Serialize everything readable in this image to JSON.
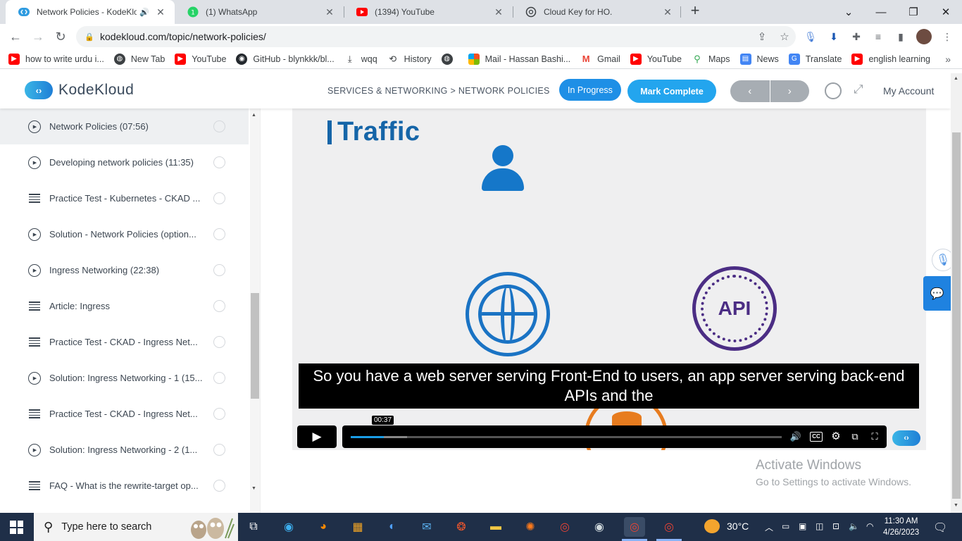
{
  "browser": {
    "tabs": [
      {
        "title": "Network Policies - KodeKlou",
        "favicon": "kodekloud-icon",
        "audio": true,
        "active": true
      },
      {
        "title": "(1) WhatsApp",
        "favicon": "whatsapp-icon",
        "active": false
      },
      {
        "title": "(1394) YouTube",
        "favicon": "youtube-icon",
        "active": false
      },
      {
        "title": "Cloud Key for HO.",
        "favicon": "chatgpt-icon",
        "active": false
      }
    ],
    "url": "kodekloud.com/topic/network-policies/",
    "bookmarks": [
      {
        "label": "how to write urdu i...",
        "icon": "youtube-icon"
      },
      {
        "label": "New Tab",
        "icon": "globe-icon"
      },
      {
        "label": "YouTube",
        "icon": "youtube-icon"
      },
      {
        "label": "GitHub - blynkkk/bl...",
        "icon": "github-icon"
      },
      {
        "label": "wqq",
        "icon": "download-icon"
      },
      {
        "label": "History",
        "icon": "history-icon"
      },
      {
        "label": "",
        "icon": "globe-icon"
      },
      {
        "label": "Mail - Hassan Bashi...",
        "icon": "microsoft-icon"
      },
      {
        "label": "Gmail",
        "icon": "gmail-icon"
      },
      {
        "label": "YouTube",
        "icon": "youtube-icon"
      },
      {
        "label": "Maps",
        "icon": "maps-icon"
      },
      {
        "label": "News",
        "icon": "news-icon"
      },
      {
        "label": "Translate",
        "icon": "translate-icon"
      },
      {
        "label": "english learning",
        "icon": "youtube-icon"
      }
    ]
  },
  "header": {
    "logo_text": "KodeKloud",
    "breadcrumb": "SERVICES & NETWORKING > NETWORK POLICIES",
    "status_label": "In Progress",
    "complete_label": "Mark Complete",
    "prev_label": "‹",
    "next_label": "›",
    "account_label": "My Account"
  },
  "sidebar": {
    "items": [
      {
        "title": "Network Policies (07:56)",
        "type": "video",
        "active": true
      },
      {
        "title": "Developing network policies (11:35)",
        "type": "video"
      },
      {
        "title": "Practice Test - Kubernetes - CKAD ...",
        "type": "text"
      },
      {
        "title": "Solution - Network Policies (option...",
        "type": "video"
      },
      {
        "title": "Ingress Networking (22:38)",
        "type": "video"
      },
      {
        "title": "Article: Ingress",
        "type": "text"
      },
      {
        "title": "Practice Test - CKAD - Ingress Net...",
        "type": "text"
      },
      {
        "title": "Solution: Ingress Networking - 1 (15...",
        "type": "video"
      },
      {
        "title": "Practice Test - CKAD - Ingress Net...",
        "type": "text"
      },
      {
        "title": "Solution: Ingress Networking - 2 (1...",
        "type": "video"
      },
      {
        "title": "FAQ - What is the rewrite-target op...",
        "type": "text"
      }
    ]
  },
  "video": {
    "slide_title": "Traffic",
    "api_label": "API",
    "caption": "So you have a web server serving Front-End to users, an app server serving back-end APIs and the",
    "current_time": "00:37",
    "played_fraction": 0.077,
    "buffered_fraction": 0.13
  },
  "watermark": {
    "line1": "Activate Windows",
    "line2": "Go to Settings to activate Windows."
  },
  "taskbar": {
    "search_placeholder": "Type here to search",
    "temperature": "30°C",
    "time": "11:30 AM",
    "date": "4/26/2023"
  }
}
